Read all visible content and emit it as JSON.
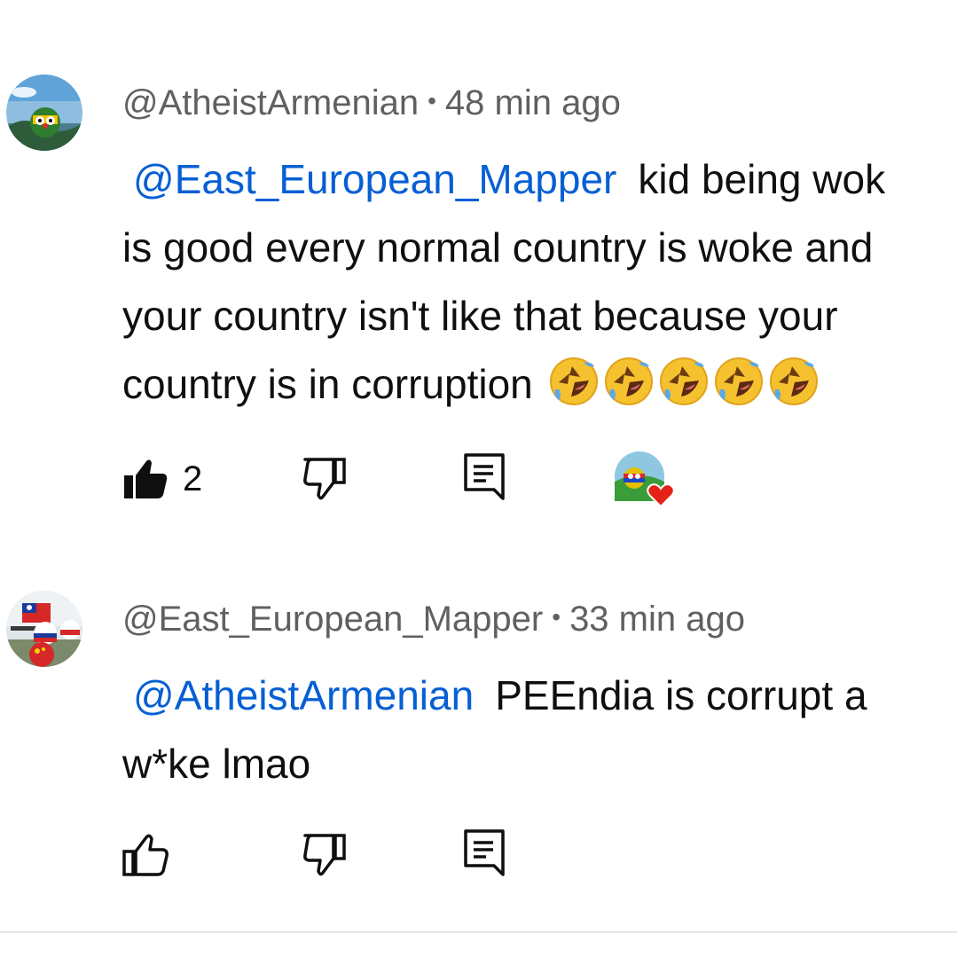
{
  "comments": [
    {
      "author": "@AtheistArmenian",
      "separator": "•",
      "time": "48 min ago",
      "mention": "@East_European_Mapper",
      "lines": [
        "kid being wok",
        "is good every normal country is woke and",
        "your country isn't like that because your",
        "country is in corruption"
      ],
      "emoji": "rolling-on-floor-laughing",
      "emoji_count": 5,
      "likes": "2",
      "liked": true,
      "creator_heart": true
    },
    {
      "author": "@East_European_Mapper",
      "separator": "•",
      "time": "33 min ago",
      "mention": "@AtheistArmenian",
      "lines": [
        "PEEndia is corrupt a",
        "w*ke lmao"
      ],
      "liked": false
    }
  ],
  "colors": {
    "mention": "#065fd4",
    "meta": "#606060",
    "text": "#0f0f0f",
    "heart": "#e62117"
  }
}
